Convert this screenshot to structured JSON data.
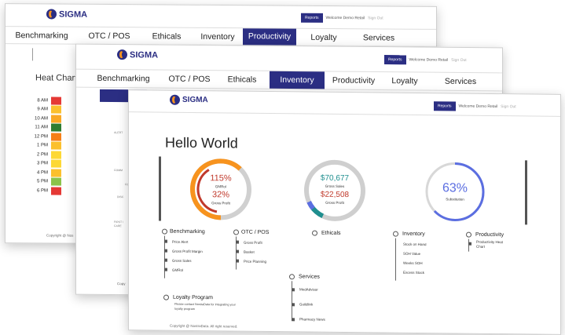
{
  "brand": "SIGMA",
  "header": {
    "reports": "Reports",
    "welcome": "Welcome Demo Retail",
    "signout": "Sign Out"
  },
  "nav": [
    "Benchmarking",
    "OTC / POS",
    "Ethicals",
    "Inventory",
    "Productivity",
    "Loyalty",
    "Services"
  ],
  "window1": {
    "active_tab": "Productivity",
    "heat_title": "Heat Chart",
    "heat": [
      {
        "time": "8 AM",
        "color": "#e53935"
      },
      {
        "time": "9 AM",
        "color": "#fbc02d"
      },
      {
        "time": "10 AM",
        "color": "#f9a825"
      },
      {
        "time": "11 AM",
        "color": "#2e7d32"
      },
      {
        "time": "12 PM",
        "color": "#f57f17"
      },
      {
        "time": "1 PM",
        "color": "#fbc02d"
      },
      {
        "time": "2 PM",
        "color": "#fdd835"
      },
      {
        "time": "3 PM",
        "color": "#fdd835"
      },
      {
        "time": "4 PM",
        "color": "#fbc02d"
      },
      {
        "time": "5 PM",
        "color": "#8bc34a"
      },
      {
        "time": "6 PM",
        "color": "#e53935"
      }
    ],
    "copyright": "Copyright @ Nos"
  },
  "window2": {
    "active_tab": "Inventory",
    "side_labels": [
      "ALERT",
      "COMM",
      "CO",
      "DISC",
      "FIRST / CARE"
    ],
    "copyright": "Copy"
  },
  "window3": {
    "page_title": "Hello World",
    "gauges": {
      "g1": {
        "v1": "115%",
        "l1": "GMRoI",
        "v2": "32%",
        "l2": "Gross Profit"
      },
      "g2": {
        "v1": "$70,677",
        "l1": "Gross Sales",
        "v2": "$22,508",
        "l2": "Gross Profit"
      },
      "g3": {
        "v1": "63%",
        "l1": "Substitution"
      }
    },
    "sections": {
      "benchmarking": {
        "title": "Benchmarking",
        "items": [
          "Price Alert",
          "Gross Profit Margin",
          "Gross Sales",
          "GMRoI"
        ]
      },
      "otc": {
        "title": "OTC / POS",
        "items": [
          "Gross Profit",
          "Basket",
          "Price Planning"
        ]
      },
      "ethicals": {
        "title": "Ethicals"
      },
      "inventory": {
        "title": "Inventory",
        "items": [
          "Stock on Hand",
          "SOH Value",
          "Weeks SOH",
          "Excess Stock"
        ]
      },
      "productivity": {
        "title": "Productivity",
        "items": [
          "Productivity Heat Chart"
        ]
      },
      "services": {
        "title": "Services",
        "items": [
          "MedAdvisor",
          "Guildlink",
          "Pharmacy News"
        ]
      },
      "loyalty": {
        "title": "Loyalty Program",
        "desc": "Please contact NostraData for integrating your loyalty program"
      }
    },
    "copyright": "Copyright @ NostraData. All right reserved.",
    "colors": {
      "accent": "#2b2e83",
      "orange": "#f7931e",
      "red": "#c0392b",
      "teal": "#1f8f8f",
      "blue": "#5b6ee1"
    }
  }
}
